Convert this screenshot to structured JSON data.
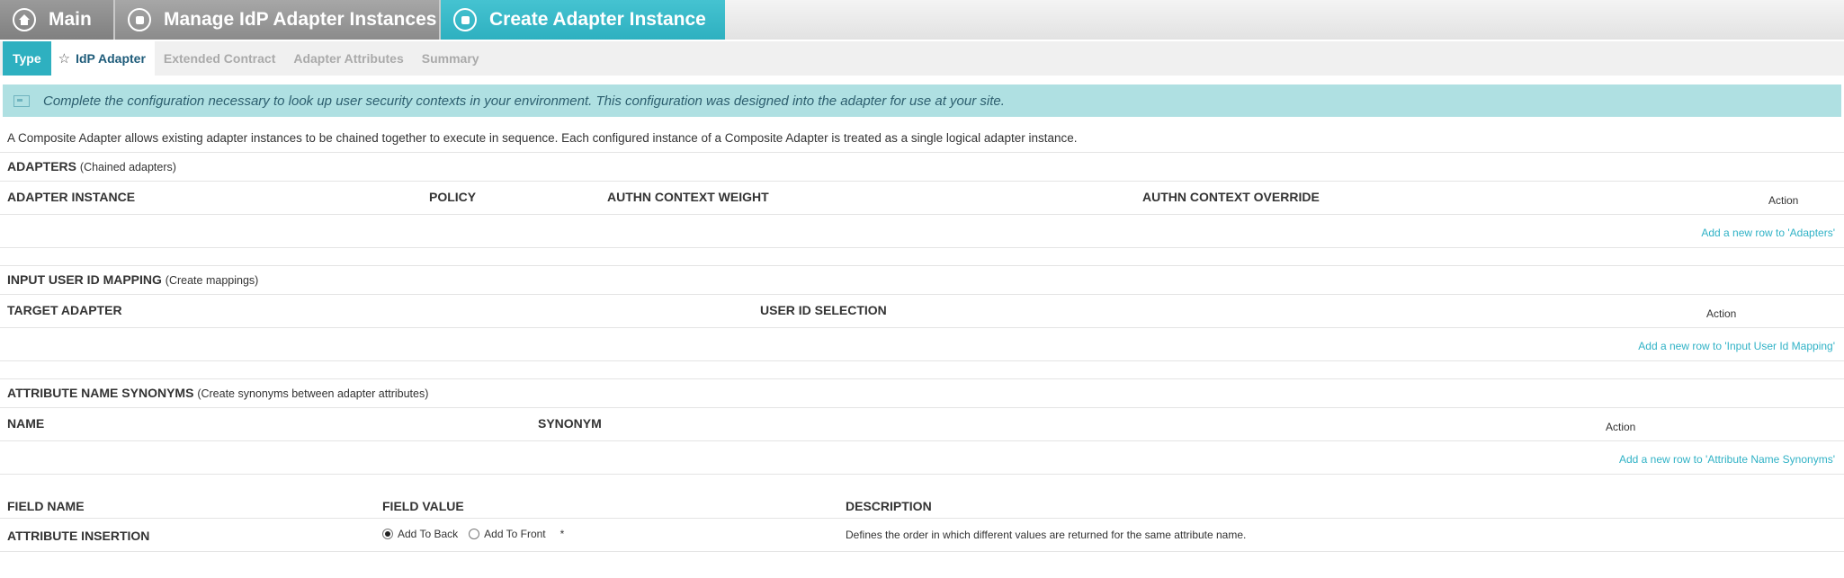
{
  "breadcrumbs": {
    "main": "Main",
    "manage": "Manage IdP Adapter Instances",
    "create": "Create Adapter Instance"
  },
  "tabs": {
    "type": "Type",
    "idp_adapter": "IdP Adapter",
    "extended_contract": "Extended Contract",
    "adapter_attributes": "Adapter Attributes",
    "summary": "Summary"
  },
  "info_message": "Complete the configuration necessary to look up user security contexts in your environment. This configuration was designed into the adapter for use at your site.",
  "description": "A Composite Adapter allows existing adapter instances to be chained together to execute in sequence. Each configured instance of a Composite Adapter is treated as a single logical adapter instance.",
  "adapters": {
    "title": "ADAPTERS",
    "subtitle": "(Chained adapters)",
    "columns": [
      "ADAPTER INSTANCE",
      "POLICY",
      "AUTHN CONTEXT WEIGHT",
      "AUTHN CONTEXT OVERRIDE"
    ],
    "action": "Action",
    "add_link": "Add a new row to 'Adapters'"
  },
  "input_mapping": {
    "title": "INPUT USER ID MAPPING",
    "subtitle": "(Create mappings)",
    "columns": [
      "TARGET ADAPTER",
      "USER ID SELECTION"
    ],
    "action": "Action",
    "add_link": "Add a new row to 'Input User Id Mapping'"
  },
  "synonyms": {
    "title": "ATTRIBUTE NAME SYNONYMS",
    "subtitle": "(Create synonyms between adapter attributes)",
    "columns": [
      "NAME",
      "SYNONYM"
    ],
    "action": "Action",
    "add_link": "Add a new row to 'Attribute Name Synonyms'"
  },
  "fields": {
    "columns": [
      "FIELD NAME",
      "FIELD VALUE",
      "DESCRIPTION"
    ],
    "rows": [
      {
        "name": "ATTRIBUTE INSERTION",
        "option1": "Add To Back",
        "option2": "Add To Front",
        "selected": "Add To Back",
        "required_mark": "*",
        "description": "Defines the order in which different values are returned for the same attribute name."
      }
    ]
  },
  "colors": {
    "accent": "#2eb0c0",
    "info_bg": "#afe0e2",
    "link": "#30b2c6"
  }
}
